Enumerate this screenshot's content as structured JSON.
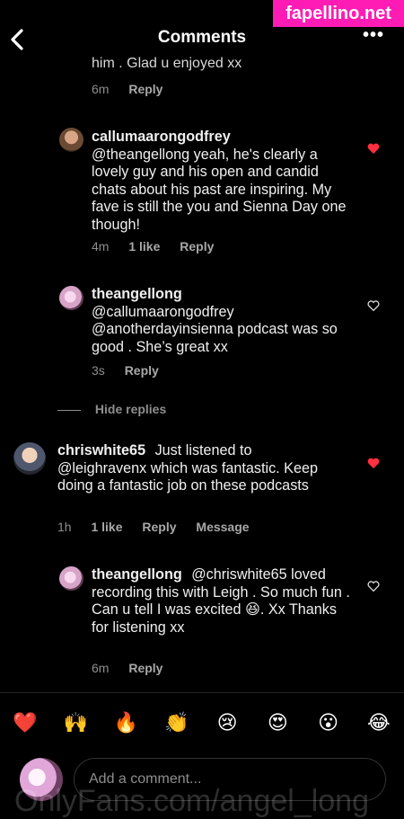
{
  "header": {
    "title": "Comments",
    "more": "•••",
    "badge": "fapellino.net"
  },
  "thread": {
    "cut_text": "him . Glad u enjoyed xx",
    "cut_meta": {
      "time": "6m",
      "reply": "Reply"
    }
  },
  "comments": [
    {
      "user": "callumaarongodfrey",
      "text": "@theangellong yeah, he's clearly a lovely guy and his open and candid chats about his past are inspiring. My fave is still the you and Sienna Day one though!",
      "time": "4m",
      "likes": "1 like",
      "reply": "Reply",
      "liked": true
    },
    {
      "user": "theangellong",
      "text": "@callumaarongodfrey @anotherdayinsienna podcast was so good . She’s great xx",
      "time": "3s",
      "reply": "Reply",
      "liked": false
    },
    {
      "hide_replies": "Hide replies"
    },
    {
      "user": "chriswhite65",
      "text": "Just listened to @leighravenx which was fantastic. Keep doing a fantastic job on these podcasts",
      "time": "1h",
      "likes": "1 like",
      "reply": "Reply",
      "message": "Message",
      "liked": true
    },
    {
      "user": "theangellong",
      "text": "@chriswhite65 loved recording this with Leigh . So much fun . Can u tell I was excited 😆. Xx Thanks for listening xx",
      "time": "6m",
      "reply": "Reply",
      "liked": false
    }
  ],
  "emojis": [
    "❤️",
    "🙌",
    "🔥",
    "👏",
    "😢",
    "😍",
    "😮",
    "😂"
  ],
  "composer": {
    "placeholder": "Add a comment..."
  },
  "footer_watermark": "OnlyFans.com/angel_long",
  "colors": {
    "heart": "#ff3040",
    "muted": "#8e8e8e",
    "badge": "#ff1cb5"
  }
}
